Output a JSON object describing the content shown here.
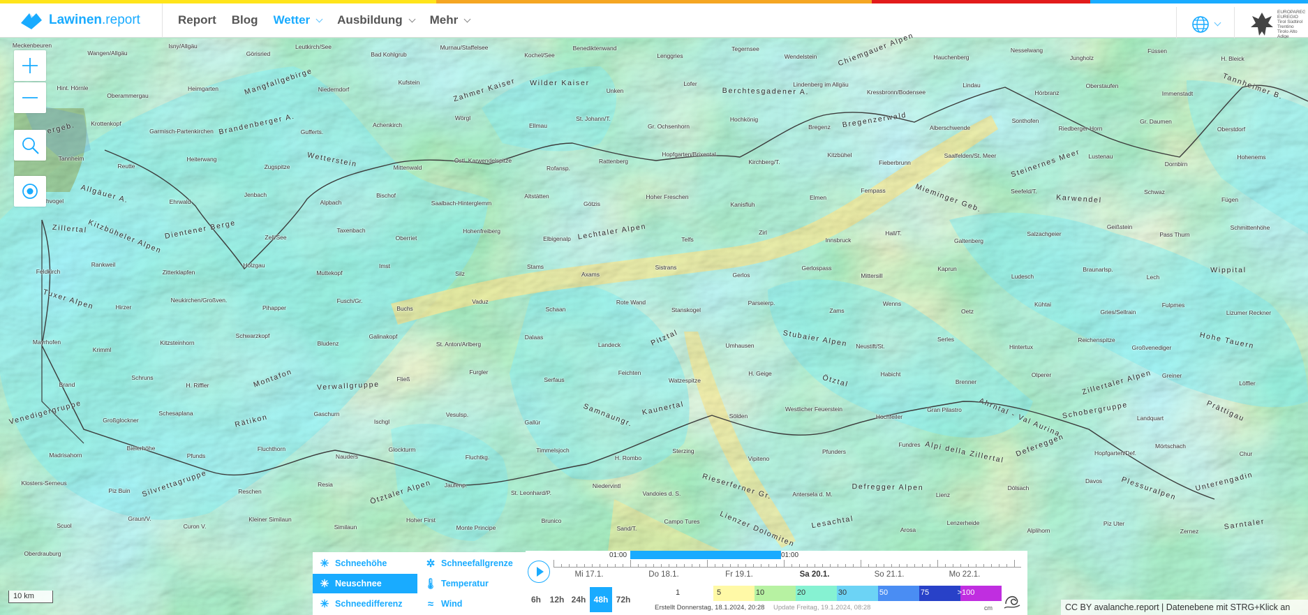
{
  "brand": {
    "name": "Lawinen",
    "suffix": ".report",
    "color": "#19abff"
  },
  "top_colors": [
    "#ffe41a",
    "#ffe41a",
    "#f5a623",
    "#f5a623",
    "#e21b1b",
    "#19abff"
  ],
  "nav": {
    "items": [
      {
        "label": "Report",
        "active": false,
        "dropdown": false
      },
      {
        "label": "Blog",
        "active": false,
        "dropdown": false
      },
      {
        "label": "Wetter",
        "active": true,
        "dropdown": true
      },
      {
        "label": "Ausbildung",
        "active": false,
        "dropdown": true
      },
      {
        "label": "Mehr",
        "active": false,
        "dropdown": true
      }
    ],
    "language_icon": "globe-icon",
    "partner_text": "EUROPAREGION EUREGIO Tirol Südtirol Trentino Tirolo Alto Adige"
  },
  "map": {
    "controls": [
      "zoom-in-icon",
      "zoom-out-icon",
      "search-icon",
      "locate-icon"
    ],
    "places": [
      "Meckenbeuren",
      "Wangen/Allgäu",
      "Isny/Allgäu",
      "Görisried",
      "Leutkirch/See",
      "Bad Kohlgrub",
      "Murnau/Staffelsee",
      "Kochel/See",
      "Benediktenwand",
      "Lenggries",
      "Tegernsee",
      "Wendelstein",
      "Chiemgauer Alpen",
      "Hauchenberg",
      "Nesselwang",
      "Jungholz",
      "Füssen",
      "H. Bleick",
      "Hint. Hörnle",
      "Oberammergau",
      "Heimgarten",
      "Mangfallgebirge",
      "Niederndorf",
      "Kufstein",
      "Zahmer Kaiser",
      "Wilder Kaiser",
      "Unken",
      "Lofer",
      "Berchtesgadener A.",
      "Lindenberg im Allgäu",
      "Kressbronn/Bodensee",
      "Lindau",
      "Hörbranz",
      "Oberstaufen",
      "Immenstadt",
      "Tannheimer B.",
      "Ammergeb.",
      "Krottenkopf",
      "Garmisch-Partenkirchen",
      "Brandenberger A.",
      "Gufferts.",
      "Achenkirch",
      "Wörgl",
      "Ellmau",
      "St. Johann/T.",
      "Gr. Ochsenhorn",
      "Hochkönig",
      "Bregenz",
      "Bregenzerwald",
      "Alberschwende",
      "Sonthofen",
      "Riedberger Horn",
      "Gr. Daumen",
      "Oberstdorf",
      "Tannheim",
      "Reutte",
      "Heiterwang",
      "Zugspitze",
      "Wetterstein",
      "Mittenwald",
      "Östl. Karwendelspitze",
      "Rofansp.",
      "Rattenberg",
      "Hopfgarten/Brixental",
      "Kirchberg/T.",
      "Kitzbühel",
      "Fieberbrunn",
      "Saalfelden/St. Meer",
      "Steinernes Meer",
      "Lustenau",
      "Dornbirn",
      "Hohenems",
      "Hochvogel",
      "Allgäuer A.",
      "Ehrwald",
      "Jenbach",
      "Alpbach",
      "Bischof",
      "Saalbach-Hinterglemm",
      "Altstätten",
      "Götzis",
      "Hoher Freschen",
      "Kanisfluh",
      "Elmen",
      "Fernpass",
      "Mieminger Geb.",
      "Seefeld/T.",
      "Karwendel",
      "Schwaz",
      "Fügen",
      "Zillertal",
      "Kitzbüheler Alpen",
      "Dientener Berge",
      "Zell/See",
      "Taxenbach",
      "Oberriet",
      "Hohenfreiberg",
      "Elbigenalp",
      "Lechtaler Alpen",
      "Telfs",
      "Zirl",
      "Innsbruck",
      "Hall/T.",
      "Galtenberg",
      "Salzachgeier",
      "Geißstein",
      "Pass Thurn",
      "Schmittenhöhe",
      "Feldkirch",
      "Rankweil",
      "Zitterklapfen",
      "Holzgau",
      "Muttekopf",
      "Imst",
      "Silz",
      "Stams",
      "Axams",
      "Sistrans",
      "Gerlos",
      "Gerlospass",
      "Mittersill",
      "Kaprun",
      "Ludesch",
      "Braunarlsp.",
      "Lech",
      "Wippital",
      "Tuxer Alpen",
      "Hirzer",
      "Neukirchen/Großven.",
      "Pihapper",
      "Fusch/Gr.",
      "Buchs",
      "Vaduz",
      "Schaan",
      "Rote Wand",
      "Stanskogel",
      "Parseierp.",
      "Zams",
      "Wenns",
      "Oetz",
      "Kühtai",
      "Gries/Sellrain",
      "Fulpmes",
      "Lizumer Reckner",
      "Mayrhofen",
      "Krimml",
      "Kitzsteinhorn",
      "Schwarzkopf",
      "Bludenz",
      "Galinakopf",
      "St. Anton/Arlberg",
      "Dalaas",
      "Landeck",
      "Pitztal",
      "Umhausen",
      "Stubaier Alpen",
      "Neustift/St.",
      "Serles",
      "Hintertux",
      "Reichenspitze",
      "Großvenediger",
      "Hohe Tauern",
      "Brand",
      "Schruns",
      "H. Riffler",
      "Montafon",
      "Verwallgruppe",
      "Fließ",
      "Furgler",
      "Serfaus",
      "Feichten",
      "Watzespitze",
      "H. Geige",
      "Ötztal",
      "Habicht",
      "Brenner",
      "Olperer",
      "Zillertaler Alpen",
      "Greiner",
      "Löffler",
      "Venedigergruppe",
      "Großglockner",
      "Schesaplana",
      "Rätikon",
      "Gaschurn",
      "Ischgl",
      "Vesulsp.",
      "Gallür",
      "Samnaungr.",
      "Kaunertal",
      "Sölden",
      "Westlicher Feuerstein",
      "Hochfeiler",
      "Gran Pilastro",
      "Ahrntal - Val Aurina",
      "Schobergruppe",
      "Landquart",
      "Prättigau",
      "Madrisahorn",
      "Bielerhöhe",
      "Pfunds",
      "Fluchthorn",
      "Nauders",
      "Glockturm",
      "Fluchtkg.",
      "Timmelsjoch",
      "H. Rombo",
      "Sterzing",
      "Vipiteno",
      "Pfunders",
      "Fundres",
      "Alpi della Zillertal",
      "Defereggen",
      "Hopfgarten/Def.",
      "Mörtschach",
      "Chur",
      "Klosters-Serneus",
      "Piz Buin",
      "Silvrettagruppe",
      "Reschen",
      "Resia",
      "Ötztaler Alpen",
      "Jaufenp.",
      "St. Leonhard/P.",
      "Niedervintl",
      "Vandoies d. S.",
      "Rieserferner Gr.",
      "Antersela d. M.",
      "Defregger Alpen",
      "Lienz",
      "Dölsach",
      "Davos",
      "Plessuralpen",
      "Unterengadin",
      "Scuol",
      "Graun/V.",
      "Curon V.",
      "Kleiner Similaun",
      "Similaun",
      "Hoher First",
      "Monte Principe",
      "Brunico",
      "Sand/T.",
      "Campo Tures",
      "Lienzer Dolomiten",
      "Lesachtal",
      "Arosa",
      "Lenzerheide",
      "Alplihorn",
      "Piz Uter",
      "Zernez",
      "Sarntaler",
      "Oberdrauburg"
    ],
    "scale_label": "10 km"
  },
  "layers": [
    {
      "label": "Schneehöhe",
      "icon": "snowflake-icon",
      "selected": false
    },
    {
      "label": "Schneefallgrenze",
      "icon": "snowfall-line-icon",
      "selected": false
    },
    {
      "label": "Neuschnee",
      "icon": "new-snow-icon",
      "selected": true
    },
    {
      "label": "Temperatur",
      "icon": "thermometer-icon",
      "selected": false
    },
    {
      "label": "Schneedifferenz",
      "icon": "snow-diff-icon",
      "selected": false
    },
    {
      "label": "Wind",
      "icon": "wind-icon",
      "selected": false
    }
  ],
  "timeline": {
    "start_time": "01:00",
    "end_time": "01:00",
    "days": [
      {
        "label": "Mi 17.1.",
        "current": false
      },
      {
        "label": "Do 18.1.",
        "current": false
      },
      {
        "label": "Fr 19.1.",
        "current": false
      },
      {
        "label": "Sa 20.1.",
        "current": true
      },
      {
        "label": "So 21.1.",
        "current": false
      },
      {
        "label": "Mo 22.1.",
        "current": false
      }
    ],
    "ranges": [
      {
        "label": "6h",
        "selected": false
      },
      {
        "label": "12h",
        "selected": false
      },
      {
        "label": "24h",
        "selected": false
      },
      {
        "label": "48h",
        "selected": true
      },
      {
        "label": "72h",
        "selected": false
      }
    ],
    "created": "Erstellt Donnerstag, 18.1.2024, 20:28",
    "updated": "Update Freitag, 19.1.2024, 08:28"
  },
  "legend": {
    "unit": "cm",
    "values": [
      "1",
      "5",
      "10",
      "20",
      "30",
      "50",
      "75",
      ">100"
    ],
    "colors": [
      "#ffffff",
      "#fff9a6",
      "#b7f2a2",
      "#86f2d2",
      "#6cd3f5",
      "#4a8df3",
      "#2841c8",
      "#c02ee0"
    ]
  },
  "attribution": "CC BY avalanche.report | Datenebene mit STRG+Klick an"
}
